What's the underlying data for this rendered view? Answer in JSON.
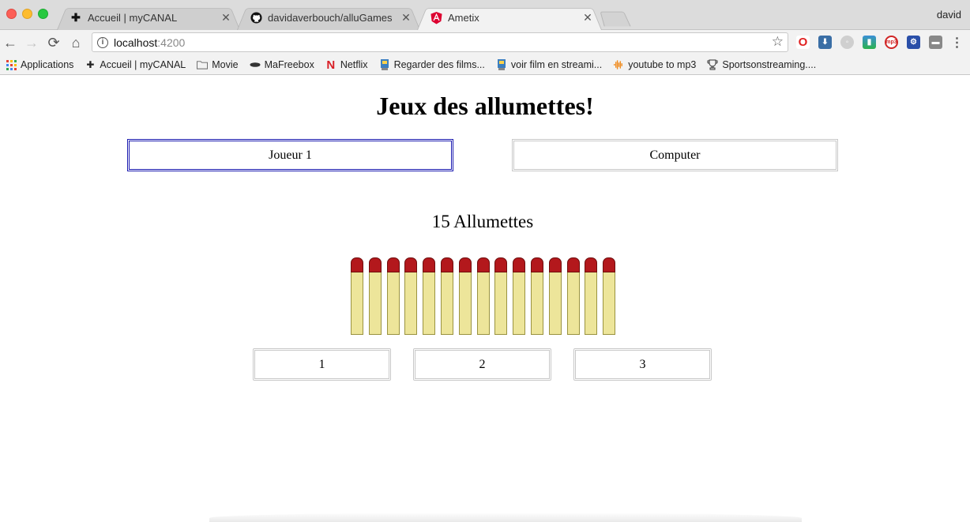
{
  "browser": {
    "profile_name": "david",
    "tabs": [
      {
        "title": "Accueil | myCANAL",
        "icon": "plus-icon",
        "active": false
      },
      {
        "title": "davidaverbouch/alluGames",
        "icon": "github-icon",
        "active": false
      },
      {
        "title": "Ametix",
        "icon": "angular-icon",
        "active": true
      }
    ],
    "tab_close_glyph": "✕",
    "address": {
      "host": "localhost",
      "port": ":4200"
    },
    "bookmarks": [
      {
        "label": "Applications",
        "icon": "apps-grid-icon"
      },
      {
        "label": "Accueil | myCANAL",
        "icon": "plus-icon"
      },
      {
        "label": "Movie",
        "icon": "folder-icon"
      },
      {
        "label": "MaFreebox",
        "icon": "freebox-icon"
      },
      {
        "label": "Netflix",
        "icon": "netflix-icon"
      },
      {
        "label": "Regarder des films...",
        "icon": "film-icon"
      },
      {
        "label": "voir film en streami...",
        "icon": "film-icon"
      },
      {
        "label": "youtube to mp3",
        "icon": "audio-wave-icon"
      },
      {
        "label": "Sportsonstreaming....",
        "icon": "trophy-icon"
      }
    ]
  },
  "game": {
    "title": "Jeux des allumettes!",
    "players": [
      {
        "label": "Joueur 1",
        "active": true
      },
      {
        "label": "Computer",
        "active": false
      }
    ],
    "count_label": "15 Allumettes",
    "matches_remaining": 15,
    "take_options": [
      "1",
      "2",
      "3"
    ]
  },
  "colors": {
    "active_player_border": "#1a1ab0",
    "match_head": "#b3181c",
    "match_stick": "#ede59a"
  }
}
